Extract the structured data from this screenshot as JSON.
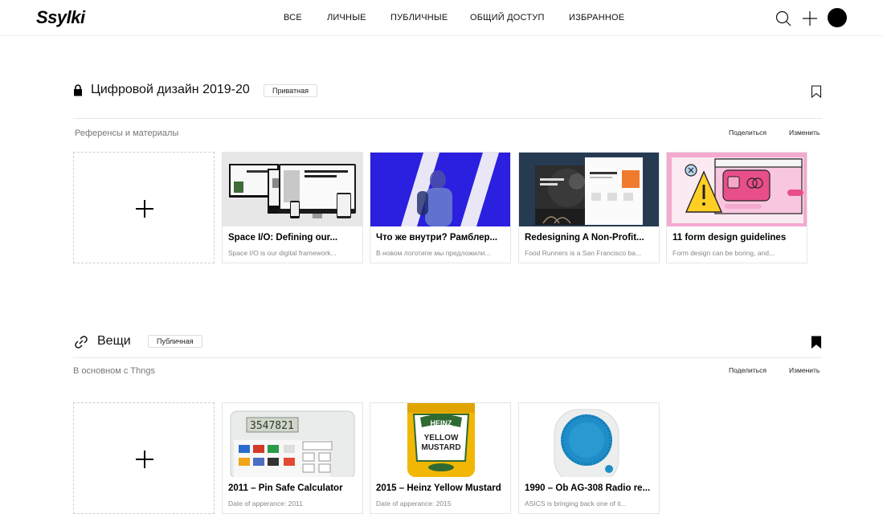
{
  "app": {
    "logo": "Ssylki"
  },
  "nav": {
    "all": "ВСЕ",
    "personal": "ЛИЧНЫЕ",
    "public": "ПУБЛИЧНЫЕ",
    "shared": "ОБЩИЙ ДОСТУП",
    "favorites": "ИЗБРАННОЕ"
  },
  "header_icons": [
    "search-icon",
    "plus-icon",
    "avatar"
  ],
  "collections": [
    {
      "icon": "lock-icon",
      "title": "Цифровой дизайн 2019-20",
      "badge": "Приватная",
      "bookmarked": false,
      "description": "Референсы и материалы",
      "share_label": "Поделиться",
      "edit_label": "Изменить",
      "cards": [
        {
          "title": "Space I/O: Defining our...",
          "description": "Space I/O is our digital framework..."
        },
        {
          "title": "Что же внутри? Рамблер...",
          "description": "В новом логотипе мы предложили..."
        },
        {
          "title": "Redesigning A Non-Profit...",
          "description": "Food Runners is a San Francisco ba..."
        },
        {
          "title": "11 form design guidelines",
          "description": "Form design can be boring, and..."
        }
      ]
    },
    {
      "icon": "link-icon",
      "title": "Вещи",
      "badge": "Публичная",
      "bookmarked": true,
      "description": "В основном с Thngs",
      "share_label": "Поделиться",
      "edit_label": "Изменить",
      "cards": [
        {
          "title": "2011 – Pin Safe Calculator",
          "description": "Date of apperance: 2011"
        },
        {
          "title": "2015 – Heinz Yellow Mustard",
          "description": "Date of apperance: 2015"
        },
        {
          "title": "1990 – Ob AG-308 Radio re...",
          "description": "ASICS is bringing back one of it..."
        }
      ]
    }
  ],
  "thumb_text": {
    "calc_display": "3547821",
    "mustard_brand": "HEINZ",
    "mustard_line1": "YELLOW",
    "mustard_line2": "MUSTARD"
  },
  "colors": {
    "accent": "#000000",
    "rambler_blue": "#2b1fe0",
    "mustard": "#f2b705",
    "radio_blue": "#1f8ec8"
  }
}
